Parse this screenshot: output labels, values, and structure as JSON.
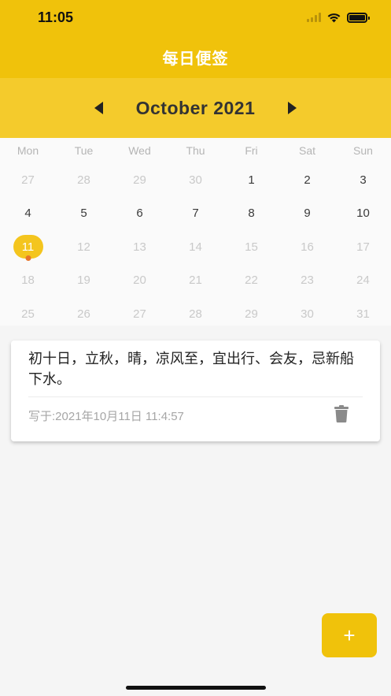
{
  "status_bar": {
    "time": "11:05"
  },
  "app_bar": {
    "title": "每日便签"
  },
  "month_header": {
    "label": "October 2021"
  },
  "calendar": {
    "weekdays": [
      "Mon",
      "Tue",
      "Wed",
      "Thu",
      "Fri",
      "Sat",
      "Sun"
    ],
    "weeks": [
      [
        {
          "d": "27",
          "s": "muted"
        },
        {
          "d": "28",
          "s": "muted"
        },
        {
          "d": "29",
          "s": "muted"
        },
        {
          "d": "30",
          "s": "muted"
        },
        {
          "d": "1",
          "s": "normal"
        },
        {
          "d": "2",
          "s": "normal"
        },
        {
          "d": "3",
          "s": "normal"
        }
      ],
      [
        {
          "d": "4",
          "s": "normal"
        },
        {
          "d": "5",
          "s": "normal"
        },
        {
          "d": "6",
          "s": "normal"
        },
        {
          "d": "7",
          "s": "normal"
        },
        {
          "d": "8",
          "s": "normal"
        },
        {
          "d": "9",
          "s": "normal"
        },
        {
          "d": "10",
          "s": "normal"
        }
      ],
      [
        {
          "d": "11",
          "s": "selected"
        },
        {
          "d": "12",
          "s": "muted"
        },
        {
          "d": "13",
          "s": "muted"
        },
        {
          "d": "14",
          "s": "muted"
        },
        {
          "d": "15",
          "s": "muted"
        },
        {
          "d": "16",
          "s": "muted"
        },
        {
          "d": "17",
          "s": "muted"
        }
      ],
      [
        {
          "d": "18",
          "s": "muted"
        },
        {
          "d": "19",
          "s": "muted"
        },
        {
          "d": "20",
          "s": "muted"
        },
        {
          "d": "21",
          "s": "muted"
        },
        {
          "d": "22",
          "s": "muted"
        },
        {
          "d": "23",
          "s": "muted"
        },
        {
          "d": "24",
          "s": "muted"
        }
      ],
      [
        {
          "d": "25",
          "s": "muted"
        },
        {
          "d": "26",
          "s": "muted"
        },
        {
          "d": "27",
          "s": "muted"
        },
        {
          "d": "28",
          "s": "muted"
        },
        {
          "d": "29",
          "s": "muted"
        },
        {
          "d": "30",
          "s": "muted"
        },
        {
          "d": "31",
          "s": "muted"
        }
      ]
    ]
  },
  "note": {
    "text": "初十日，立秋，晴，凉风至，宜出行、会友，忌新船下水。",
    "meta": "写于:2021年10月11日 11:4:57",
    "delete_icon": "trash-icon"
  },
  "fab": {
    "label": "+"
  },
  "colors": {
    "primary": "#f0c20b",
    "month_bar": "#f4cb2c",
    "selected_day": "#f4c51e",
    "event_dot": "#e8752b"
  }
}
